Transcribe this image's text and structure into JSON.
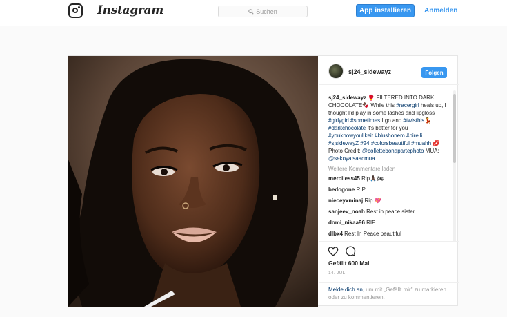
{
  "nav": {
    "brand": "Instagram",
    "search_placeholder": "Suchen",
    "install_label": "App installieren",
    "login_label": "Anmelden"
  },
  "post": {
    "username": "sj24_sidewayz",
    "follow_label": "Folgen",
    "caption": {
      "username": "sj24_sidewayz",
      "text_parts": [
        "🥊 FILTERED INTO DARK CHOCOLATE🍫 While this ",
        "#racergirl",
        " heals up, I thought I'd play in some lashes and lipgloss ",
        "#girlygirl",
        " ",
        "#sometimes",
        " I go and ",
        "#twisthis",
        "💃 ",
        "#darkchocolate",
        " it's better for you ",
        "#youknowyoulikeit",
        " ",
        "#blushonem",
        " ",
        "#pirelli",
        " ",
        "#sjsidewayZ",
        " ",
        "#24",
        " ",
        "#colorsbeautiful",
        " ",
        "#muahh",
        " 💋 Photo Credit: ",
        "@collettebonapartephoto",
        " MUA: ",
        "@sekoyaisaacmua"
      ]
    },
    "load_more": "Weitere Kommentare laden",
    "comments": [
      {
        "user": "merciless45",
        "text": "Rip🙏🏿🏍"
      },
      {
        "user": "bedogone",
        "text": "RIP"
      },
      {
        "user": "nieceyxminaj",
        "text": "Rip 💖"
      },
      {
        "user": "sanjeev_noah",
        "text": "Rest in peace sister"
      },
      {
        "user": "domi_nikaa96",
        "text": "RIP"
      },
      {
        "user": "dlbx4",
        "text": "Rest In Peace beautiful"
      }
    ],
    "likes": "Gefällt 600 Mal",
    "date": "14. JULI",
    "login_hint_link": "Melde dich an",
    "login_hint_rest": ", um mit „Gefällt mir\" zu markieren oder zu kommentieren."
  },
  "icons": {
    "brand_glyph": "instagram-camera-icon",
    "search": "search-icon",
    "like": "heart-icon",
    "comment": "comment-bubble-icon"
  },
  "colors": {
    "accent": "#3897f0",
    "hashtag": "#003569",
    "muted": "#999999"
  }
}
